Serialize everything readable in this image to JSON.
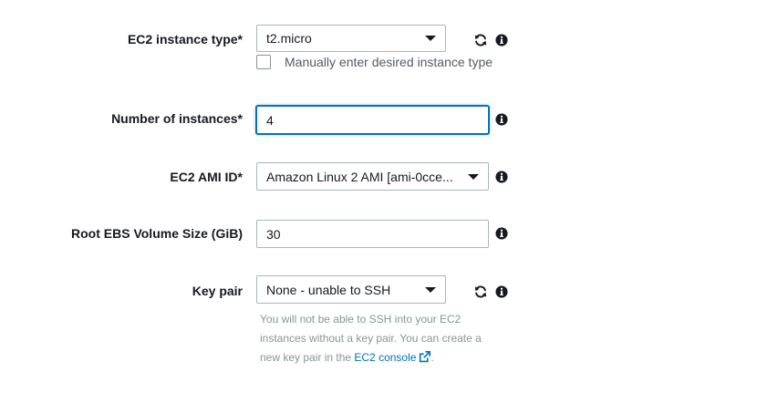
{
  "instance_type": {
    "label": "EC2 instance type*",
    "value": "t2.micro",
    "manual_checkbox_label": "Manually enter desired instance type",
    "manual_checked": false
  },
  "num_instances": {
    "label": "Number of instances*",
    "value": "4"
  },
  "ami": {
    "label": "EC2 AMI ID*",
    "value": "Amazon Linux 2 AMI [ami-0cce..."
  },
  "root_volume": {
    "label": "Root EBS Volume Size (GiB)",
    "value": "30"
  },
  "key_pair": {
    "label": "Key pair",
    "value": "None - unable to SSH",
    "hint_text": "You will not be able to SSH into your EC2 instances without a key pair. You can create a new key pair in the ",
    "hint_link": "EC2 console",
    "hint_suffix": "."
  },
  "icons": {
    "refresh": "refresh-icon",
    "info": "info-icon",
    "external_link": "external-link-icon"
  },
  "colors": {
    "focus_border": "#0073bb",
    "link": "#0073bb",
    "hint_text": "#879596"
  }
}
